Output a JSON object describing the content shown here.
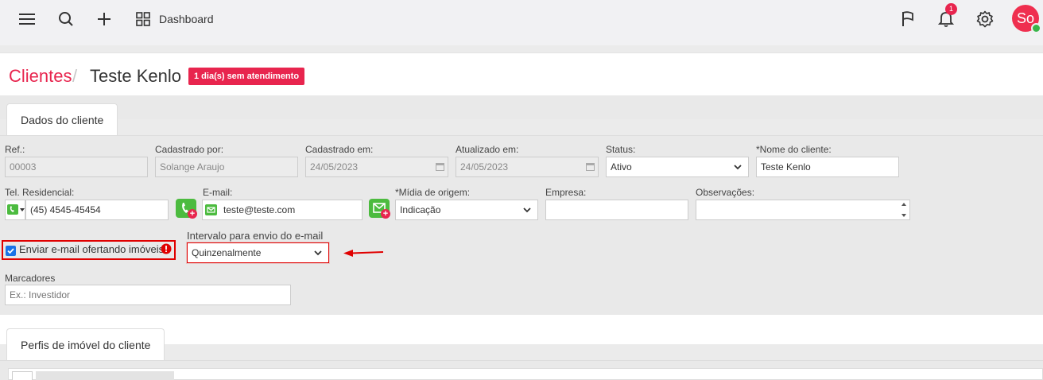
{
  "topbar": {
    "dashboard_label": "Dashboard",
    "notification_count": "1",
    "avatar_initials": "So",
    "icons": [
      "menu-icon",
      "search-icon",
      "plus-icon",
      "dashboard-grid-icon",
      "flag-icon",
      "bell-icon",
      "gear-icon"
    ]
  },
  "header": {
    "breadcrumb": "Clientes",
    "separator": "/",
    "title": "Teste Kenlo",
    "alert_badge": "1 dia(s) sem atendimento"
  },
  "section_client": {
    "tab_label": "Dados do cliente",
    "fields": {
      "ref": {
        "label": "Ref.:",
        "value": "00003"
      },
      "cadastrado_por": {
        "label": "Cadastrado por:",
        "value": "Solange Araujo"
      },
      "cadastrado_em": {
        "label": "Cadastrado em:",
        "value": "24/05/2023"
      },
      "atualizado_em": {
        "label": "Atualizado em:",
        "value": "24/05/2023"
      },
      "status": {
        "label": "Status:",
        "value": "Ativo"
      },
      "nome": {
        "label": "*Nome do cliente:",
        "value": "Teste Kenlo"
      },
      "tel": {
        "label": "Tel. Residencial:",
        "value": "(45) 4545-45454"
      },
      "email": {
        "label": "E-mail:",
        "value": "teste@teste.com"
      },
      "midia": {
        "label": "*Mídia de origem:",
        "value": "Indicação"
      },
      "empresa": {
        "label": "Empresa:",
        "value": ""
      },
      "observacoes": {
        "label": "Observações:",
        "value": ""
      },
      "enviar_email": {
        "label": "Enviar e-mail ofertando imóveis",
        "checked": true
      },
      "intervalo": {
        "label": "Intervalo para envio do e-mail",
        "value": "Quinzenalmente"
      },
      "marcadores": {
        "label": "Marcadores",
        "placeholder": "Ex.: Investidor"
      }
    }
  },
  "section_perfis": {
    "tab_label": "Perfis de imóvel do cliente"
  },
  "colors": {
    "brand_red": "#e8254e",
    "whatsapp_green": "#4cbb3f",
    "highlight_red": "#e00000"
  }
}
